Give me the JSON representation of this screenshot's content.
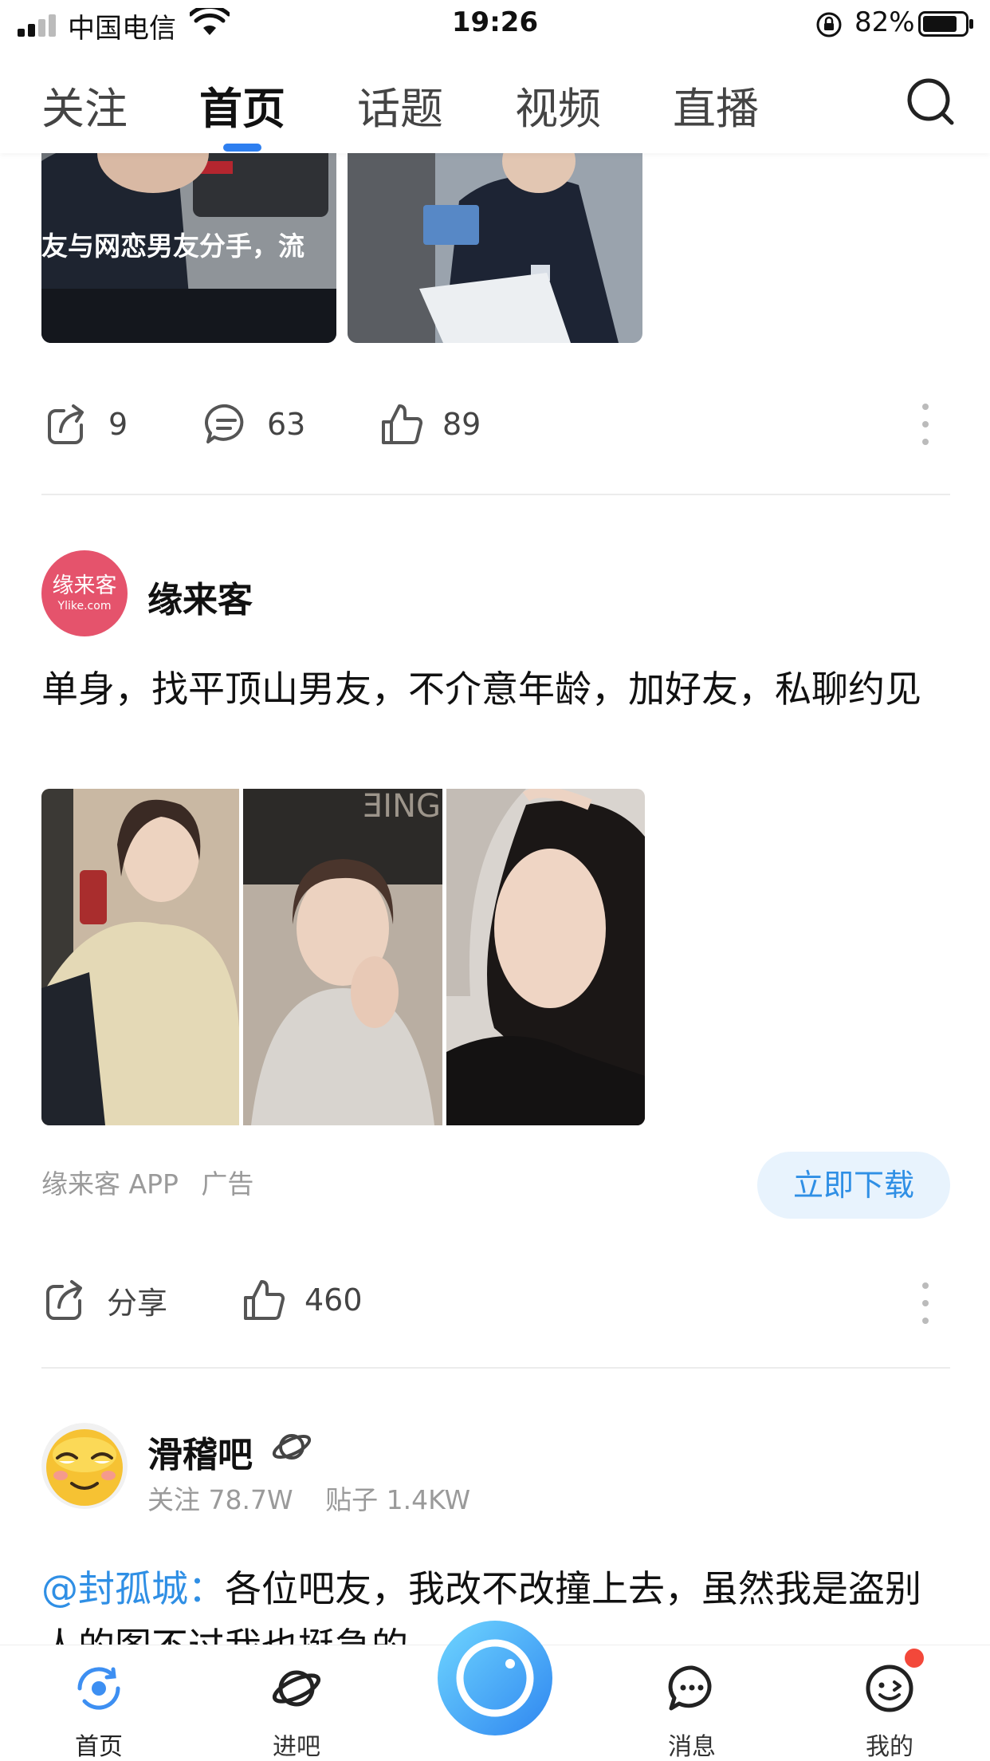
{
  "status_bar": {
    "carrier": "中国电信",
    "time": "19:26",
    "battery": "82%"
  },
  "nav": {
    "tabs": [
      "关注",
      "首页",
      "话题",
      "视频",
      "直播"
    ],
    "active": "首页"
  },
  "post1": {
    "image_caption": "友与网恋男友分手，流",
    "share_count": "9",
    "comment_count": "63",
    "like_count": "89"
  },
  "ad": {
    "avatar_text": "缘来客",
    "avatar_subtext": "Ylike.com",
    "author": "缘来客",
    "text": "单身，找平顶山男友，不介意年龄，加好友，私聊约见",
    "source": "缘来客 APP",
    "ad_label": "广告",
    "download_label": "立即下载",
    "share_label": "分享",
    "like_count": "460"
  },
  "post3": {
    "forum": "滑稽吧",
    "follow_label": "关注 78.7W",
    "posts_label": "贴子 1.4KW",
    "mention": "@封孤城：",
    "text": "各位吧友，我改不改撞上去，虽然我是盗别人的图不过我也挺急的"
  },
  "tabbar": {
    "home": "首页",
    "enter_forum": "进吧",
    "messages": "消息",
    "mine": "我的"
  },
  "colors": {
    "accent": "#2e7ff0",
    "link": "#2f8fe5",
    "badge": "#f3483a",
    "ad_avatar": "#e5536c"
  }
}
